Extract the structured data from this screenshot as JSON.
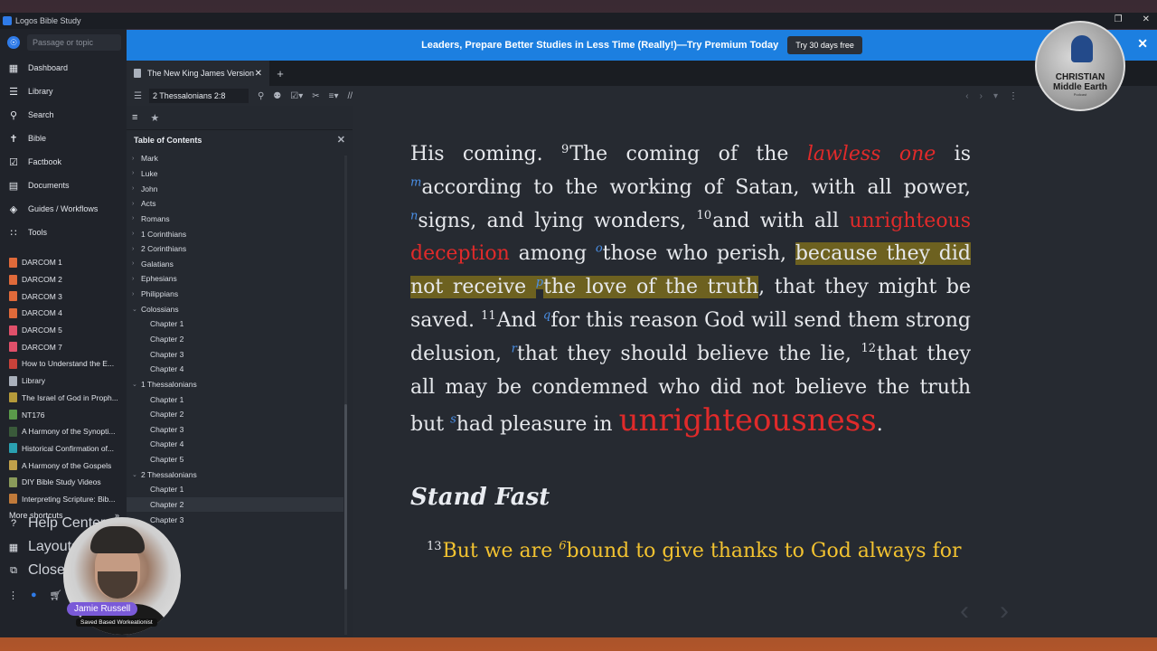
{
  "app": {
    "title": "Logos Bible Study"
  },
  "sidebar": {
    "search_placeholder": "Passage or topic",
    "nav": [
      {
        "label": "Dashboard",
        "icon": "dashboard-icon"
      },
      {
        "label": "Library",
        "icon": "library-icon"
      },
      {
        "label": "Search",
        "icon": "search-icon"
      },
      {
        "label": "Bible",
        "icon": "bible-icon"
      },
      {
        "label": "Factbook",
        "icon": "factbook-icon"
      },
      {
        "label": "Documents",
        "icon": "documents-icon"
      },
      {
        "label": "Guides / Workflows",
        "icon": "guides-icon"
      },
      {
        "label": "Tools",
        "icon": "tools-icon"
      }
    ],
    "shortcuts": [
      {
        "label": "DARCOM 1",
        "color": "#e06a3a"
      },
      {
        "label": "DARCOM 2",
        "color": "#e06a3a"
      },
      {
        "label": "DARCOM 3",
        "color": "#e06a3a"
      },
      {
        "label": "DARCOM 4",
        "color": "#e06a3a"
      },
      {
        "label": "DARCOM 5",
        "color": "#e06a3a"
      },
      {
        "label": "DARCOM 7",
        "color": "#e06a3a"
      },
      {
        "label": "How to Understand the E...",
        "color": "#c8423a"
      },
      {
        "label": "Library",
        "color": "#a9b0bb"
      },
      {
        "label": "The Israel of God in Proph...",
        "color": "#b59a3a"
      },
      {
        "label": "NT176",
        "color": "#5a9a4a"
      },
      {
        "label": "A Harmony of the Synopti...",
        "color": "#3a5a3a"
      },
      {
        "label": "Historical Confirmation of...",
        "color": "#2aa0b0"
      },
      {
        "label": "A Harmony of the Gospels",
        "color": "#c0a04a"
      },
      {
        "label": "DIY Bible Study Videos",
        "color": "#8a9a5a"
      },
      {
        "label": "Interpreting Scripture: Bib...",
        "color": "#c07a3a"
      }
    ],
    "more_shortcuts": "More shortcuts",
    "bottom_nav": [
      {
        "label": "Help Center",
        "icon": "help-icon"
      },
      {
        "label": "Layouts",
        "icon": "layouts-icon"
      },
      {
        "label": "Close all",
        "icon": "close-all-icon"
      }
    ]
  },
  "banner": {
    "text": "Leaders, Prepare Better Studies in Less Time (Really!)—Try Premium Today",
    "button": "Try 30 days free"
  },
  "tabs": [
    {
      "label": "The New King James Version"
    }
  ],
  "toolbar": {
    "reference": "2 Thessalonians 2:8"
  },
  "toc": {
    "title": "Table of Contents",
    "items": [
      {
        "label": "Mark",
        "level": 0,
        "expanded": false
      },
      {
        "label": "Luke",
        "level": 0,
        "expanded": false
      },
      {
        "label": "John",
        "level": 0,
        "expanded": false
      },
      {
        "label": "Acts",
        "level": 0,
        "expanded": false
      },
      {
        "label": "Romans",
        "level": 0,
        "expanded": false
      },
      {
        "label": "1 Corinthians",
        "level": 0,
        "expanded": false
      },
      {
        "label": "2 Corinthians",
        "level": 0,
        "expanded": false
      },
      {
        "label": "Galatians",
        "level": 0,
        "expanded": false
      },
      {
        "label": "Ephesians",
        "level": 0,
        "expanded": false
      },
      {
        "label": "Philippians",
        "level": 0,
        "expanded": false
      },
      {
        "label": "Colossians",
        "level": 0,
        "expanded": true
      },
      {
        "label": "Chapter 1",
        "level": 1
      },
      {
        "label": "Chapter 2",
        "level": 1
      },
      {
        "label": "Chapter 3",
        "level": 1
      },
      {
        "label": "Chapter 4",
        "level": 1
      },
      {
        "label": "1 Thessalonians",
        "level": 0,
        "expanded": true
      },
      {
        "label": "Chapter 1",
        "level": 1
      },
      {
        "label": "Chapter 2",
        "level": 1
      },
      {
        "label": "Chapter 3",
        "level": 1
      },
      {
        "label": "Chapter 4",
        "level": 1
      },
      {
        "label": "Chapter 5",
        "level": 1
      },
      {
        "label": "2 Thessalonians",
        "level": 0,
        "expanded": true
      },
      {
        "label": "Chapter 1",
        "level": 1
      },
      {
        "label": "Chapter 2",
        "level": 1,
        "selected": true
      },
      {
        "label": "Chapter 3",
        "level": 1
      }
    ]
  },
  "reader": {
    "p1": {
      "t0": "His coming.",
      "v9": "9",
      "t1": "The coming of the",
      "red1": "lawless one",
      "t2": "is",
      "fn_m": "m",
      "t3": "according to the working of Satan, with all power,",
      "fn_n": "n",
      "t4": "signs, and lying wonders,",
      "v10": "10",
      "t5": "and with all",
      "red2": "unrighteous deception",
      "t6": "among",
      "fn_o": "o",
      "t7": "those who perish,",
      "hl1": "because they did not receive",
      "fn_p": "p",
      "hl2": "the love of the truth",
      "t8": ", that they might be saved.",
      "v11": "11",
      "t9": "And",
      "fn_q": "q",
      "t10": "for this reason God will send them strong delusion,",
      "fn_r": "r",
      "t11": "that they should believe the lie,",
      "v12": "12",
      "t12": "that they all may be condemned who did not believe the truth but",
      "fn_s": "s",
      "t13": "had pleasure in",
      "red3": "unrighteousness",
      "t14": "."
    },
    "heading": "Stand Fast",
    "p2": {
      "v13": "13",
      "t0": "But we are",
      "fn_6": "6",
      "t1": "bound to give thanks to God always for"
    }
  },
  "overlay": {
    "logo_line1": "CHRISTIAN",
    "logo_line2": "Middle Earth",
    "logo_line3": "Podcast",
    "presenter_name": "Jamie Russell",
    "presenter_sub": "Saved Based Workeationist"
  }
}
